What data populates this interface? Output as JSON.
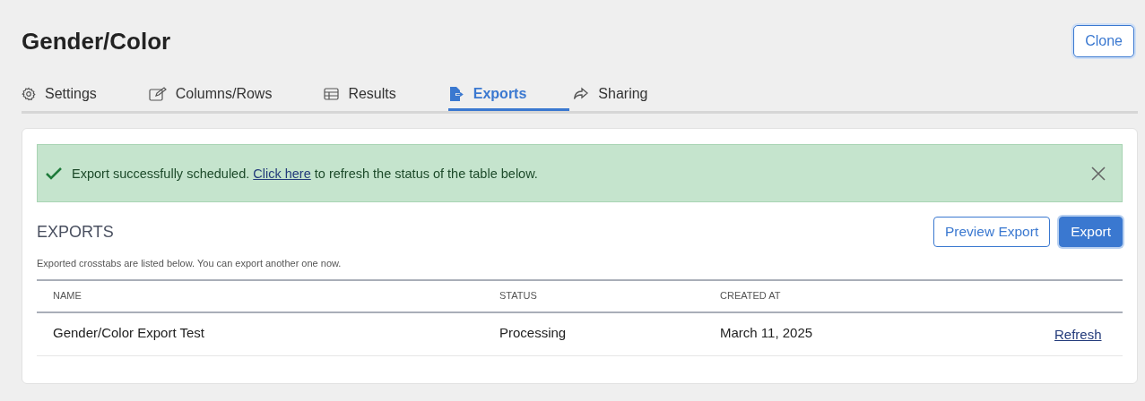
{
  "page": {
    "title": "Gender/Color",
    "clone_button": "Clone"
  },
  "tabs": [
    {
      "label": "Settings",
      "selected": false
    },
    {
      "label": "Columns/Rows",
      "selected": false
    },
    {
      "label": "Results",
      "selected": false
    },
    {
      "label": "Exports",
      "selected": true
    },
    {
      "label": "Sharing",
      "selected": false
    }
  ],
  "alert": {
    "text_before": "Export successfully scheduled. ",
    "link": "Click here",
    "text_after": " to refresh the status of the table below."
  },
  "exports": {
    "heading": "EXPORTS",
    "description": "Exported crosstabs are listed below. You can export another one now.",
    "buttons": [
      {
        "label": "Preview Export",
        "kind": "secondary"
      },
      {
        "label": "Export",
        "kind": "primary"
      }
    ],
    "columns": [
      "NAME",
      "STATUS",
      "CREATED AT"
    ],
    "rows": [
      {
        "name": "Gender/Color Export Test",
        "status": "Processing",
        "created_at": "March 11, 2025",
        "action": "Refresh"
      }
    ]
  }
}
